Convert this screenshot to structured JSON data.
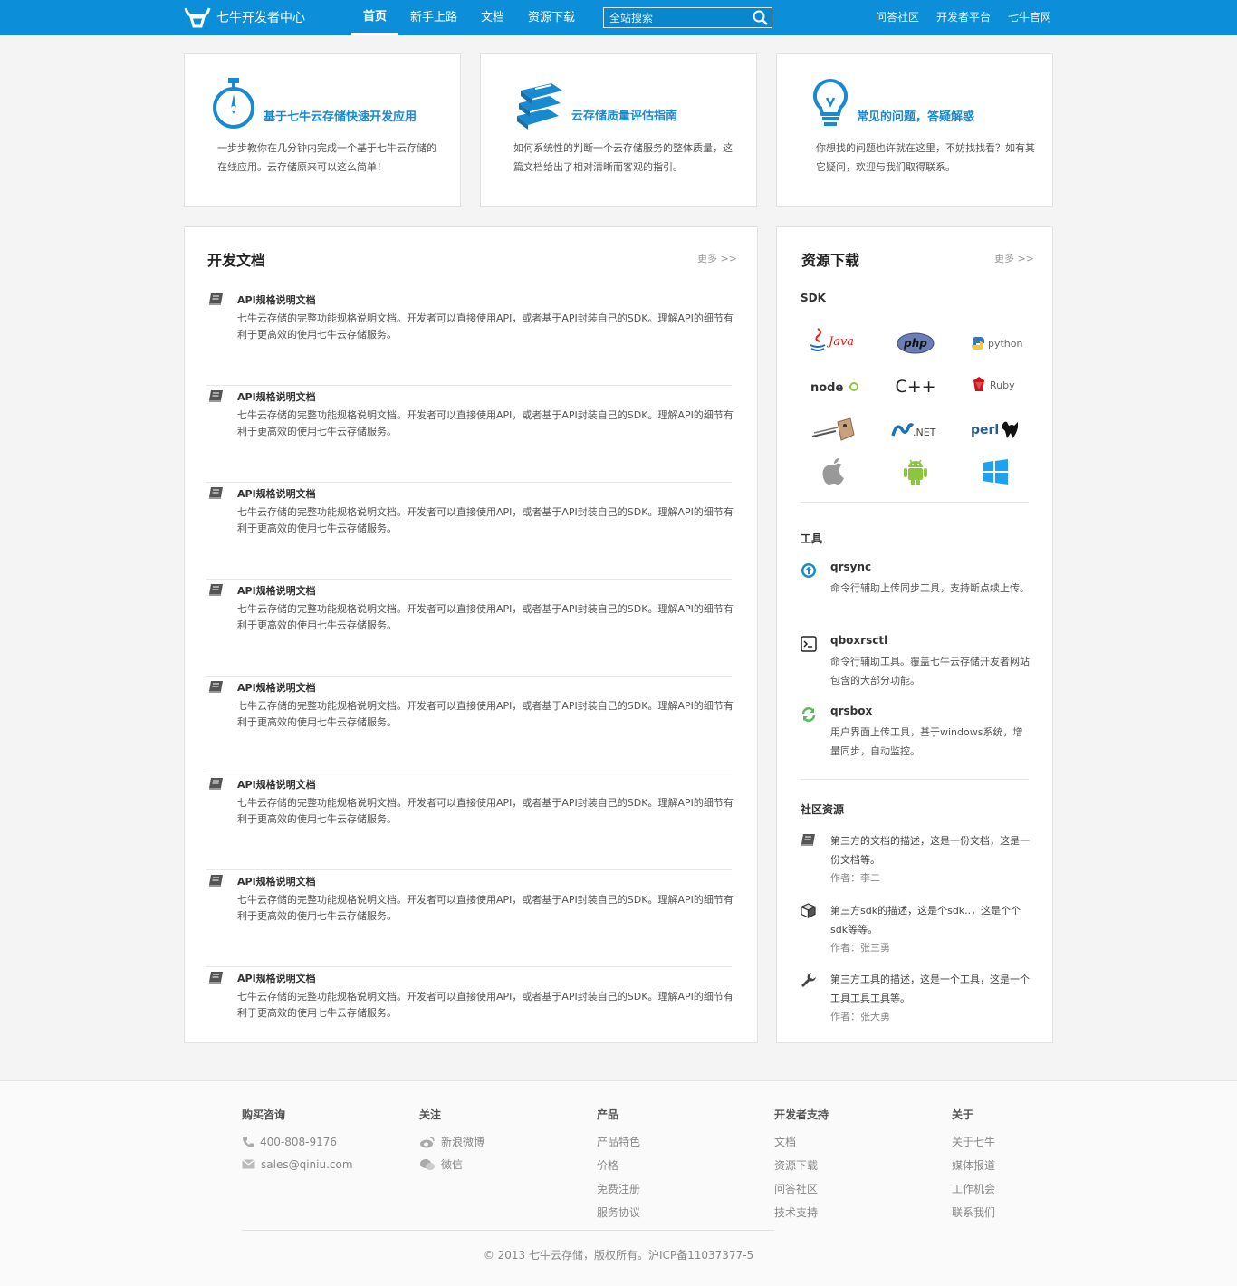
{
  "header": {
    "logo_text": "七牛开发者中心",
    "nav": [
      "首页",
      "新手上路",
      "文档",
      "资源下载"
    ],
    "search_placeholder": "全站搜索",
    "right_links": [
      "问答社区",
      "开发者平台",
      "七牛官网"
    ]
  },
  "features": [
    {
      "title": "基于七牛云存储快速开发应用",
      "desc": "一步步教你在几分钟内完成一个基于七牛云存储的在线应用。云存储原来可以这么简单！"
    },
    {
      "title": "云存储质量评估指南",
      "desc": "如何系统性的判断一个云存储服务的整体质量，这篇文档给出了相对清晰而客观的指引。"
    },
    {
      "title": "常见的问题，答疑解惑",
      "desc": "你想找的问题也许就在这里，不妨找找看？如有其它疑问，欢迎与我们取得联系。"
    }
  ],
  "docs": {
    "title": "开发文档",
    "more": "更多 >>",
    "items": [
      {
        "title": "API规格说明文档",
        "desc": "七牛云存储的完整功能规格说明文档。开发者可以直接使用API，或者基于API封装自己的SDK。理解API的细节有利于更高效的使用七牛云存储服务。"
      },
      {
        "title": "API规格说明文档",
        "desc": "七牛云存储的完整功能规格说明文档。开发者可以直接使用API，或者基于API封装自己的SDK。理解API的细节有利于更高效的使用七牛云存储服务。"
      },
      {
        "title": "API规格说明文档",
        "desc": "七牛云存储的完整功能规格说明文档。开发者可以直接使用API，或者基于API封装自己的SDK。理解API的细节有利于更高效的使用七牛云存储服务。"
      },
      {
        "title": "API规格说明文档",
        "desc": "七牛云存储的完整功能规格说明文档。开发者可以直接使用API，或者基于API封装自己的SDK。理解API的细节有利于更高效的使用七牛云存储服务。"
      },
      {
        "title": "API规格说明文档",
        "desc": "七牛云存储的完整功能规格说明文档。开发者可以直接使用API，或者基于API封装自己的SDK。理解API的细节有利于更高效的使用七牛云存储服务。"
      },
      {
        "title": "API规格说明文档",
        "desc": "七牛云存储的完整功能规格说明文档。开发者可以直接使用API，或者基于API封装自己的SDK。理解API的细节有利于更高效的使用七牛云存储服务。"
      },
      {
        "title": "API规格说明文档",
        "desc": "七牛云存储的完整功能规格说明文档。开发者可以直接使用API，或者基于API封装自己的SDK。理解API的细节有利于更高效的使用七牛云存储服务。"
      },
      {
        "title": "API规格说明文档",
        "desc": "七牛云存储的完整功能规格说明文档。开发者可以直接使用API，或者基于API封装自己的SDK。理解API的细节有利于更高效的使用七牛云存储服务。"
      }
    ]
  },
  "resources": {
    "title": "资源下载",
    "more": "更多 >>",
    "sdk_title": "SDK",
    "sdk_labels": {
      "java": "Java",
      "php": "php",
      "python": "python",
      "node": "node",
      "cpp": "C++",
      "ruby": "Ruby",
      "net": ".NET",
      "perl": "perl"
    },
    "tools_title": "工具",
    "tools": [
      {
        "name": "qrsync",
        "desc": "命令行辅助上传同步工具，支持断点续上传。"
      },
      {
        "name": "qboxrsctl",
        "desc": "命令行辅助工具。覆盖七牛云存储开发者网站包含的大部分功能。"
      },
      {
        "name": "qrsbox",
        "desc": "用户界面上传工具，基于windows系统，增量同步，自动监控。"
      }
    ],
    "community_title": "社区资源",
    "community": [
      {
        "desc": "第三方的文档的描述，这是一份文档，这是一份文档等。",
        "author": "作者：李二"
      },
      {
        "desc": "第三方sdk的描述，这是个sdk..，这是个个sdk等等。",
        "author": "作者：张三勇"
      },
      {
        "desc": "第三方工具的描述，这是一个工具，这是一个工具工具工具等。",
        "author": "作者：张大勇"
      }
    ]
  },
  "footer": {
    "buy": {
      "title": "购买咨询",
      "phone": "400-808-9176",
      "email": "sales@qiniu.com"
    },
    "follow": {
      "title": "关注",
      "weibo": "新浪微博",
      "wechat": "微信"
    },
    "product": {
      "title": "产品",
      "links": [
        "产品特色",
        "价格",
        "免费注册",
        "服务协议"
      ]
    },
    "support": {
      "title": "开发者支持",
      "links": [
        "文档",
        "资源下载",
        "问答社区",
        "技术支持"
      ]
    },
    "about": {
      "title": "关于",
      "links": [
        "关于七牛",
        "媒体报道",
        "工作机会",
        "联系我们"
      ]
    },
    "copyright": "© 2013 七牛云存储，版权所有。沪ICP备11037377-5"
  },
  "colors": {
    "brand": "#0c8fd8",
    "accent_text": "#1a8ad0",
    "android": "#8cc63e",
    "windows": "#1ea1f1"
  }
}
